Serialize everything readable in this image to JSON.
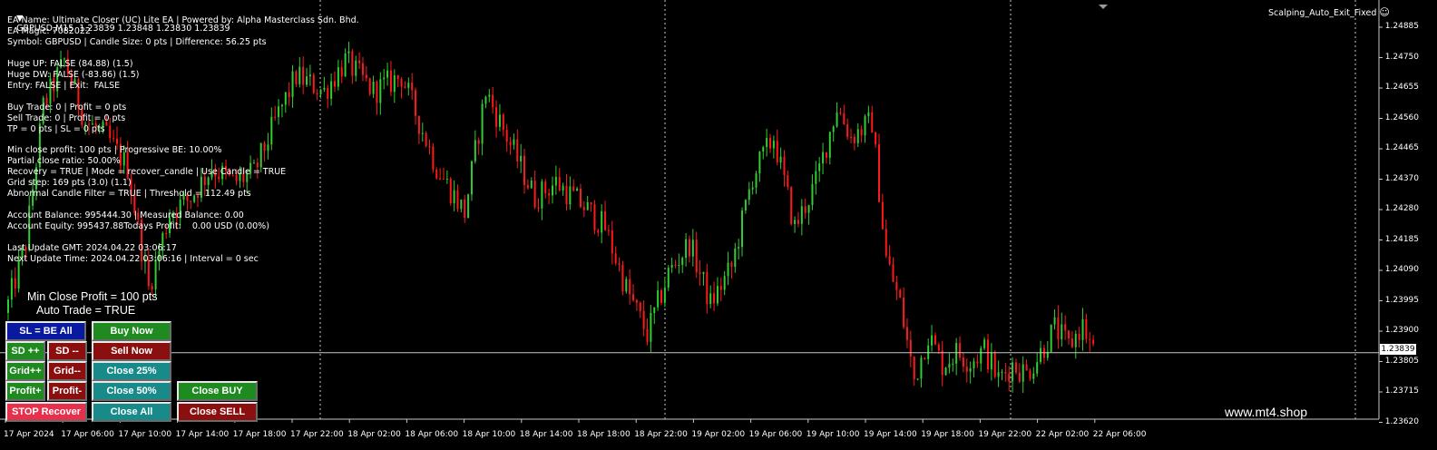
{
  "header": {
    "symbol_line": "GBPUSD,M15  1.23839 1.23848 1.23830 1.23839",
    "indicator_name": "Scalping_Auto_Exit_Fixed",
    "smiley": "☺"
  },
  "info_lines": [
    "EA Name: Ultimate Closer (UC) Lite EA | Powered by: Alpha Masterclass Sdn. Bhd.",
    "EA Magic: 7082022",
    "Symbol: GBPUSD | Candle Size: 0 pts | Difference: 56.25 pts",
    "",
    "Huge UP: FALSE (84.88) (1.5)",
    "Huge DW: FALSE (-83.86) (1.5)",
    "Entry: FALSE | Exit:  FALSE",
    "",
    "Buy Trade: 0 | Profit = 0 pts",
    "Sell Trade: 0 | Profit = 0 pts",
    "TP = 0 pts | SL = 0 pts",
    "",
    "Min close profit: 100 pts | Progressive BE: 10.00%",
    "Partial close ratio: 50.00%",
    "Recovery = TRUE | Mode = recover_candle | Use Candle = TRUE",
    "Grid step: 169 pts (3.0) (1.1)",
    "Abnormal Candle Filter = TRUE | Threshold = 112.49 pts",
    "",
    "Account Balance: 995444.30 | Measured Balance: 0.00",
    "Account Equity: 995437.88Todays Profit:    0.00 USD (0.00%)",
    "",
    "Last Update GMT: 2024.04.22 03:06:17",
    "Next Update Time: 2024.04.22 03:06:16 | Interval = 0 sec"
  ],
  "status": {
    "min_close": "Min Close Profit = 100 pts",
    "auto_trade": "Auto Trade = TRUE"
  },
  "buttons": {
    "sl_be_all": "SL = BE All",
    "buy_now": "Buy Now",
    "sd_plus": "SD ++",
    "sd_minus": "SD --",
    "sell_now": "Sell Now",
    "grid_plus": "Grid++",
    "grid_minus": "Grid--",
    "close_25": "Close 25%",
    "profit_plus": "Profit+",
    "profit_minus": "Profit-",
    "close_50": "Close 50%",
    "close_buy": "Close BUY",
    "stop_recover": "STOP Recover",
    "close_all": "Close All",
    "close_sell": "Close SELL"
  },
  "watermark": "www.mt4.shop",
  "price_axis": [
    "1.24885",
    "1.24750",
    "1.24655",
    "1.24560",
    "1.24465",
    "1.24370",
    "1.24280",
    "1.24185",
    "1.24090",
    "1.23995",
    "1.23900",
    "1.23805",
    "1.23715",
    "1.23620"
  ],
  "current_price": "1.23839",
  "time_axis": [
    "17 Apr 2024",
    "17 Apr 06:00",
    "17 Apr 10:00",
    "17 Apr 14:00",
    "17 Apr 18:00",
    "17 Apr 22:00",
    "18 Apr 02:00",
    "18 Apr 06:00",
    "18 Apr 10:00",
    "18 Apr 14:00",
    "18 Apr 18:00",
    "18 Apr 22:00",
    "19 Apr 02:00",
    "19 Apr 06:00",
    "19 Apr 10:00",
    "19 Apr 14:00",
    "19 Apr 18:00",
    "19 Apr 22:00",
    "22 Apr 02:00",
    "22 Apr 06:00"
  ],
  "colors": {
    "bull": "#32cd32",
    "bear": "#ff1a1a",
    "grid": "#c8c8c8",
    "axis": "#c8c8c8"
  },
  "chart_data": {
    "type": "candlestick",
    "symbol": "GBPUSD",
    "timeframe": "M15",
    "ylim": [
      1.2362,
      1.24935
    ],
    "last_price": 1.23839,
    "close_path": [
      [
        0,
        1.24
      ],
      [
        5,
        1.242
      ],
      [
        10,
        1.2465
      ],
      [
        16,
        1.248
      ],
      [
        22,
        1.246
      ],
      [
        28,
        1.2455
      ],
      [
        34,
        1.2445
      ],
      [
        40,
        1.2405
      ],
      [
        46,
        1.243
      ],
      [
        52,
        1.2435
      ],
      [
        58,
        1.2445
      ],
      [
        64,
        1.244
      ],
      [
        70,
        1.2443
      ],
      [
        76,
        1.246
      ],
      [
        82,
        1.2475
      ],
      [
        90,
        1.247
      ],
      [
        96,
        1.248
      ],
      [
        104,
        1.247
      ],
      [
        112,
        1.2475
      ],
      [
        122,
        1.2445
      ],
      [
        130,
        1.243
      ],
      [
        136,
        1.247
      ],
      [
        142,
        1.2455
      ],
      [
        150,
        1.2435
      ],
      [
        156,
        1.244
      ],
      [
        164,
        1.2432
      ],
      [
        170,
        1.2425
      ],
      [
        176,
        1.2405
      ],
      [
        182,
        1.239
      ],
      [
        188,
        1.241
      ],
      [
        194,
        1.242
      ],
      [
        200,
        1.24
      ],
      [
        206,
        1.2412
      ],
      [
        212,
        1.2442
      ],
      [
        218,
        1.2455
      ],
      [
        224,
        1.2425
      ],
      [
        230,
        1.244
      ],
      [
        236,
        1.2465
      ],
      [
        240,
        1.2455
      ],
      [
        246,
        1.246
      ],
      [
        250,
        1.2415
      ],
      [
        254,
        1.24
      ],
      [
        258,
        1.2375
      ],
      [
        262,
        1.239
      ],
      [
        266,
        1.238
      ],
      [
        270,
        1.2384
      ],
      [
        274,
        1.2381
      ],
      [
        278,
        1.2385
      ],
      [
        282,
        1.2375
      ],
      [
        286,
        1.238
      ],
      [
        290,
        1.2377
      ],
      [
        294,
        1.2384
      ],
      [
        298,
        1.2392
      ],
      [
        302,
        1.2386
      ],
      [
        306,
        1.2393
      ],
      [
        309,
        1.2384
      ]
    ]
  }
}
